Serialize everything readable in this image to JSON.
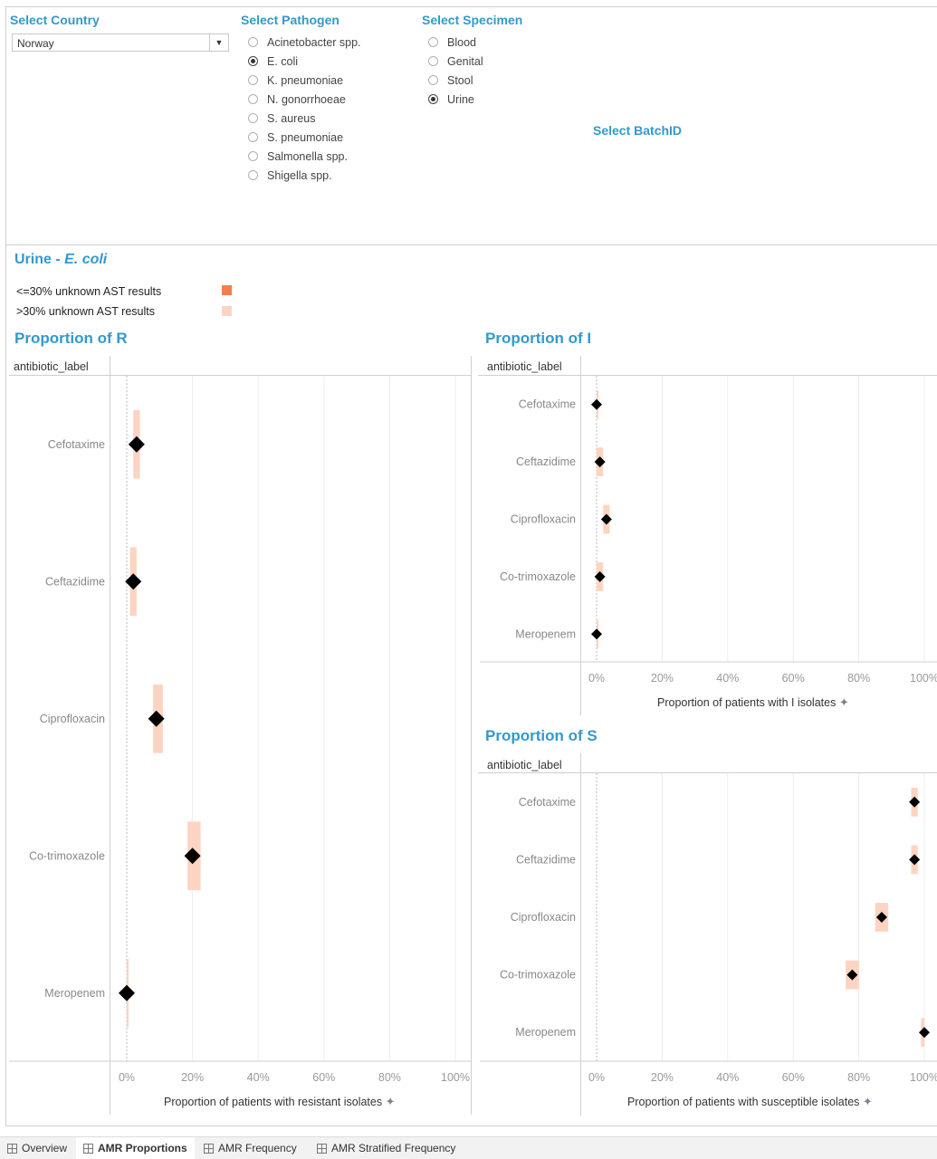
{
  "filters": {
    "country": {
      "title": "Select Country",
      "value": "Norway"
    },
    "pathogen": {
      "title": "Select Pathogen",
      "options": [
        {
          "label": "Acinetobacter spp.",
          "selected": false
        },
        {
          "label": "E. coli",
          "selected": true
        },
        {
          "label": "K. pneumoniae",
          "selected": false
        },
        {
          "label": "N. gonorrhoeae",
          "selected": false
        },
        {
          "label": "S. aureus",
          "selected": false
        },
        {
          "label": "S. pneumoniae",
          "selected": false
        },
        {
          "label": "Salmonella spp.",
          "selected": false
        },
        {
          "label": "Shigella spp.",
          "selected": false
        }
      ]
    },
    "specimen": {
      "title": "Select Specimen",
      "options": [
        {
          "label": "Blood",
          "selected": false
        },
        {
          "label": "Genital",
          "selected": false
        },
        {
          "label": "Stool",
          "selected": false
        },
        {
          "label": "Urine",
          "selected": true
        }
      ]
    },
    "batch": {
      "title": "Select BatchID"
    }
  },
  "header": {
    "specimen": "Urine",
    "separator": " - ",
    "pathogen": "E. coli"
  },
  "legend": [
    {
      "label": "<=30% unknown AST results",
      "color": "#f47d4a"
    },
    {
      "label": ">30% unknown AST results",
      "color": "#fdd4c2"
    }
  ],
  "colors": {
    "accent": "#3399cc",
    "band": "#fdd4c2",
    "marker": "#000000"
  },
  "chart_data": [
    {
      "id": "R",
      "type": "scatter",
      "title": "Proportion of R",
      "column_header": "antibiotic_label",
      "xlabel": "Proportion of patients with resistant isolates",
      "xlim": [
        0,
        100
      ],
      "xticks": [
        "0%",
        "20%",
        "40%",
        "60%",
        "80%",
        "100%"
      ],
      "categories": [
        "Cefotaxime",
        "Ceftazidime",
        "Ciprofloxacin",
        "Co-trimoxazole",
        "Meropenem"
      ],
      "values": [
        3,
        2,
        9,
        20,
        0
      ],
      "ci_low": [
        2,
        1,
        8,
        18.5,
        0
      ],
      "ci_high": [
        4,
        3,
        11,
        22.5,
        0.3
      ],
      "grid": true
    },
    {
      "id": "I",
      "type": "scatter",
      "title": "Proportion of I",
      "column_header": "antibiotic_label",
      "xlabel": "Proportion of patients with I isolates",
      "xlim": [
        0,
        100
      ],
      "xticks": [
        "0%",
        "20%",
        "40%",
        "60%",
        "80%",
        "100%"
      ],
      "categories": [
        "Cefotaxime",
        "Ceftazidime",
        "Ciprofloxacin",
        "Co-trimoxazole",
        "Meropenem"
      ],
      "values": [
        0,
        1,
        3,
        1,
        0
      ],
      "ci_low": [
        0,
        0,
        2,
        0,
        0
      ],
      "ci_high": [
        0,
        2,
        4,
        2,
        0
      ],
      "grid": true
    },
    {
      "id": "S",
      "type": "scatter",
      "title": "Proportion of S",
      "column_header": "antibiotic_label",
      "xlabel": "Proportion of patients with susceptible isolates",
      "xlim": [
        0,
        100
      ],
      "xticks": [
        "0%",
        "20%",
        "40%",
        "60%",
        "80%",
        "100%"
      ],
      "categories": [
        "Cefotaxime",
        "Ceftazidime",
        "Ciprofloxacin",
        "Co-trimoxazole",
        "Meropenem"
      ],
      "values": [
        97,
        97,
        87,
        78,
        100
      ],
      "ci_low": [
        96,
        96,
        85,
        76,
        99
      ],
      "ci_high": [
        98,
        98,
        89,
        80,
        100
      ],
      "grid": true
    }
  ],
  "tabs": [
    {
      "label": "Overview",
      "active": false
    },
    {
      "label": "AMR Proportions",
      "active": true
    },
    {
      "label": "AMR Frequency",
      "active": false
    },
    {
      "label": "AMR Stratified Frequency",
      "active": false
    }
  ]
}
